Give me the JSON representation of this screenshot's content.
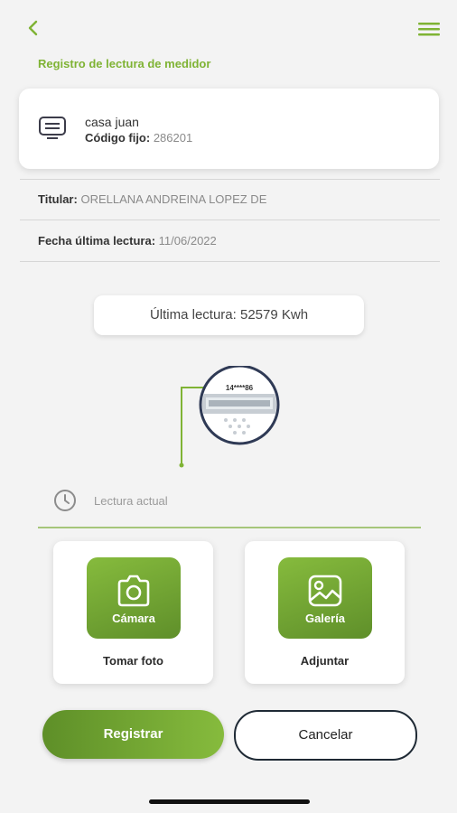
{
  "header": {
    "back_icon": "chevron-left-icon",
    "menu_icon": "hamburger-menu-icon",
    "title": "Registro de lectura de medidor"
  },
  "meter_card": {
    "icon": "meter-display-icon",
    "name": "casa juan",
    "code_label": "Código fijo:",
    "code_value": "286201"
  },
  "details": {
    "holder_label": "Titular:",
    "holder_value": "ORELLANA ANDREINA LOPEZ  DE",
    "last_date_label": "Fecha última lectura:",
    "last_date_value": "11/06/2022"
  },
  "last_reading": "Última lectura: 52579 Kwh",
  "meter_illustration": {
    "icon": "meter-illustration",
    "digits": "14****86"
  },
  "reading_input": {
    "icon": "clock-icon",
    "placeholder": "Lectura actual",
    "value": ""
  },
  "options": [
    {
      "icon": "camera-icon",
      "label": "Cámara",
      "caption": "Tomar foto"
    },
    {
      "icon": "gallery-icon",
      "label": "Galería",
      "caption": "Adjuntar"
    }
  ],
  "actions": {
    "submit_label": "Registrar",
    "cancel_label": "Cancelar"
  },
  "colors": {
    "accent": "#7fb334",
    "accent_dark": "#5f8f2a",
    "background": "#f3f3f3",
    "outline": "#1f2a35"
  }
}
